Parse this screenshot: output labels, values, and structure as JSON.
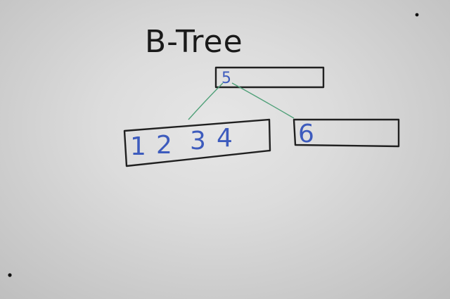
{
  "title": "B-Tree",
  "nodes": {
    "root": {
      "keys": "5"
    },
    "left": {
      "keys": [
        "1",
        "2",
        "3",
        "4"
      ]
    },
    "right": {
      "keys": "6"
    }
  },
  "colors": {
    "ink": "#202020",
    "blue_marker": "#3d5bbd",
    "green_marker": "#4fa078",
    "whiteboard": "#dcdcdc"
  }
}
